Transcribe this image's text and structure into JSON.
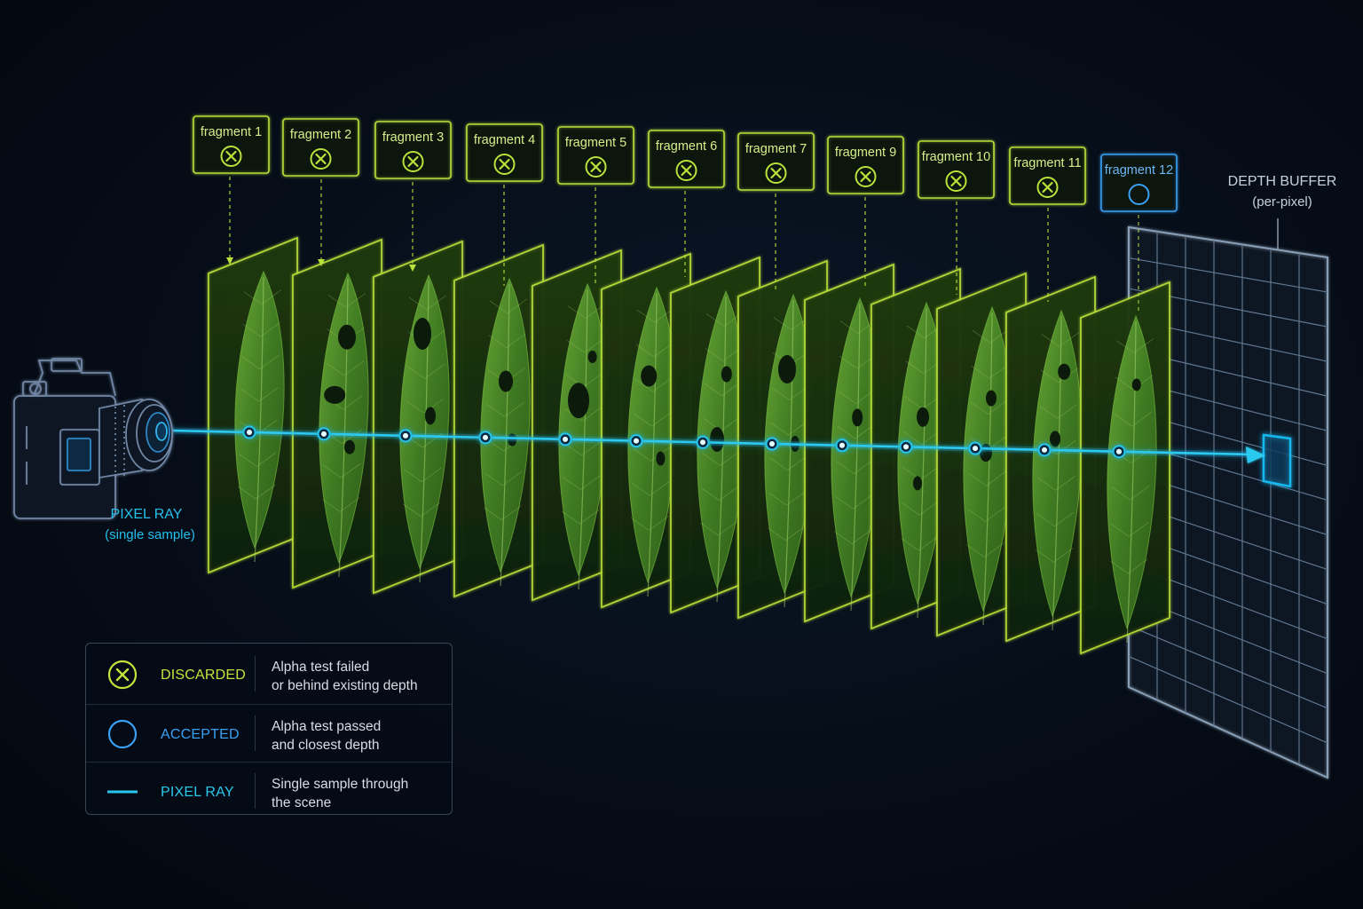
{
  "fragments": [
    {
      "label": "fragment 1",
      "status": "discarded"
    },
    {
      "label": "fragment 2",
      "status": "discarded"
    },
    {
      "label": "fragment 3",
      "status": "discarded"
    },
    {
      "label": "fragment 4",
      "status": "discarded"
    },
    {
      "label": "fragment 5",
      "status": "discarded"
    },
    {
      "label": "fragment 6",
      "status": "discarded"
    },
    {
      "label": "fragment 7",
      "status": "discarded"
    },
    {
      "label": "fragment 9",
      "status": "discarded"
    },
    {
      "label": "fragment 10",
      "status": "discarded"
    },
    {
      "label": "fragment 11",
      "status": "discarded"
    },
    {
      "label": "fragment 12",
      "status": "accepted"
    }
  ],
  "pixel_ray": {
    "title": "PIXEL RAY",
    "subtitle": "(single sample)"
  },
  "depth_buffer": {
    "title": "DEPTH BUFFER",
    "subtitle": "(per-pixel)"
  },
  "legend": {
    "discarded": {
      "label": "DISCARDED",
      "desc_line1": "Alpha test failed",
      "desc_line2": "or behind existing depth"
    },
    "accepted": {
      "label": "ACCEPTED",
      "desc_line1": "Alpha test passed",
      "desc_line2": "and closest depth"
    },
    "ray": {
      "label": "PIXEL RAY",
      "desc_line1": "Single sample through",
      "desc_line2": "the scene"
    }
  },
  "colors": {
    "discarded": "#b9e23a",
    "accepted": "#3aa0f2",
    "ray": "#27c6ec",
    "leaf": "#4f8a2a",
    "grid": "#8aa0b8"
  }
}
